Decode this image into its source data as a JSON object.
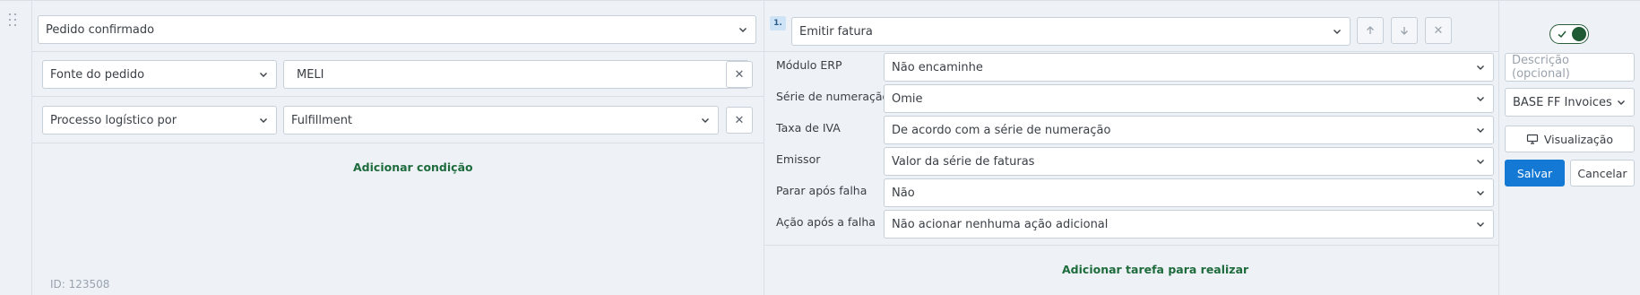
{
  "conditions": {
    "trigger_select": "Pedido confirmado",
    "rows": [
      {
        "field": "Fonte do pedido",
        "value": "MELI",
        "value_type": "text"
      },
      {
        "field": "Processo logístico por",
        "value": "Fulfillment",
        "value_type": "select"
      }
    ],
    "remove_glyph": "✕",
    "add_condition": "Adicionar condição",
    "id_label": "ID: 123508"
  },
  "task": {
    "number": "1.",
    "action_select": "Emitir fatura",
    "fields": [
      {
        "label": "Módulo ERP",
        "value": "Não encaminhe"
      },
      {
        "label": "Série de numeração",
        "value": "Omie"
      },
      {
        "label": "Taxa de IVA",
        "value": "De acordo com a série de numeração"
      },
      {
        "label": "Emissor",
        "value": "Valor da série de faturas"
      },
      {
        "label": "Parar após falha",
        "value": "Não"
      },
      {
        "label": "Ação após a falha",
        "value": "Não acionar nenhuma ação adicional"
      }
    ],
    "add_task": "Adicionar tarefa para realizar"
  },
  "side": {
    "toggle_on": true,
    "description_placeholder": "Descrição (opcional)",
    "template_select": "BASE FF Invoices",
    "preview_label": "Visualização",
    "save_label": "Salvar",
    "cancel_label": "Cancelar"
  },
  "colors": {
    "accent_green": "#1e6b3c",
    "primary_blue": "#1479d4",
    "background": "#eef2f7"
  }
}
